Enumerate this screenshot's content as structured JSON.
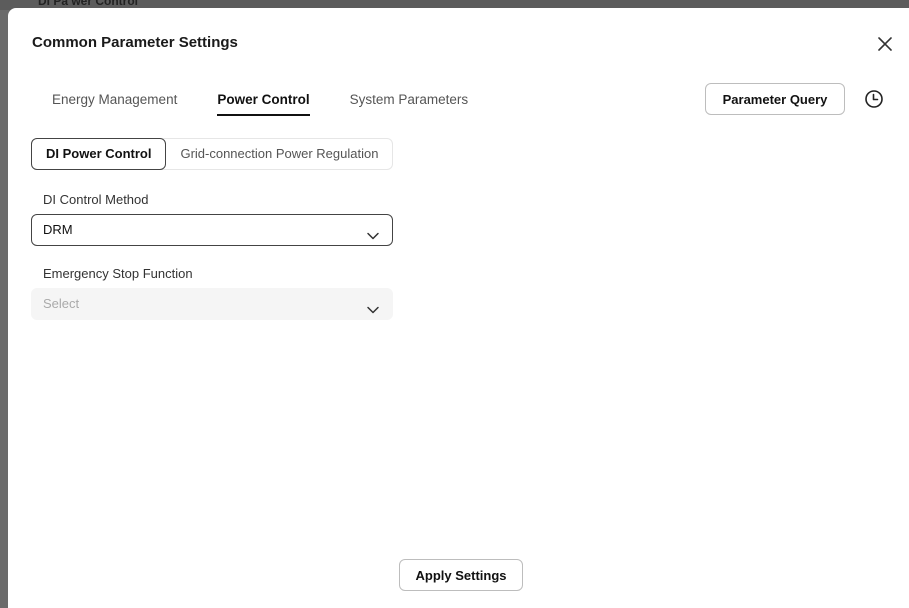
{
  "backdrop": {
    "peek_text": "DI Pa wer Control"
  },
  "dialog": {
    "title": "Common Parameter Settings",
    "close_icon": "close-icon"
  },
  "tabs": [
    {
      "label": "Energy Management",
      "active": false
    },
    {
      "label": "Power Control",
      "active": true
    },
    {
      "label": "System Parameters",
      "active": false
    }
  ],
  "toolbar": {
    "parameter_query_label": "Parameter Query",
    "history_icon": "clock-icon"
  },
  "subtabs": [
    {
      "label": "DI Power Control",
      "active": true
    },
    {
      "label": "Grid-connection Power Regulation",
      "active": false
    }
  ],
  "form": {
    "di_control_method": {
      "label": "DI Control Method",
      "value": "DRM"
    },
    "emergency_stop": {
      "label": "Emergency Stop Function",
      "placeholder": "Select"
    }
  },
  "footer": {
    "apply_label": "Apply Settings"
  }
}
